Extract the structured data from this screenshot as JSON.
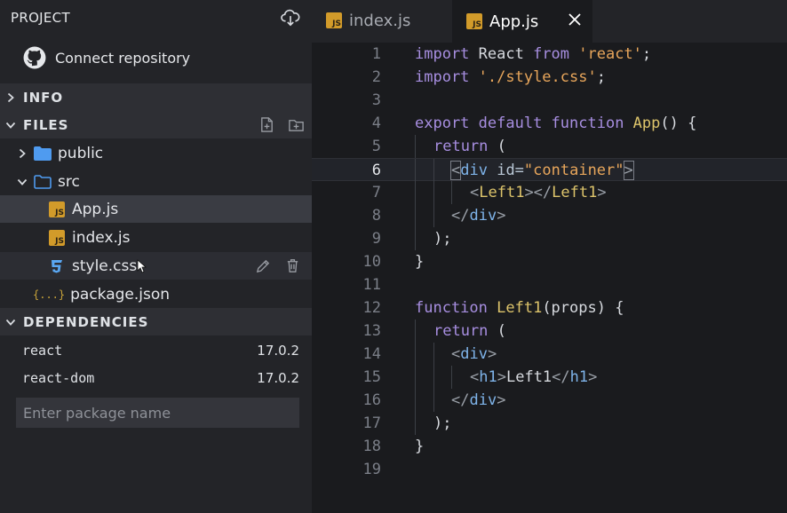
{
  "sidebar": {
    "project_title": "PROJECT",
    "connect_label": "Connect repository",
    "info_label": "INFO",
    "files_label": "FILES",
    "files": [
      {
        "name": "public",
        "type": "folder"
      },
      {
        "name": "src",
        "type": "folder-open"
      },
      {
        "name": "App.js",
        "type": "js"
      },
      {
        "name": "index.js",
        "type": "js"
      },
      {
        "name": "style.css",
        "type": "css"
      },
      {
        "name": "package.json",
        "type": "json"
      }
    ],
    "dependencies_label": "DEPENDENCIES",
    "dependencies": [
      {
        "name": "react",
        "version": "17.0.2"
      },
      {
        "name": "react-dom",
        "version": "17.0.2"
      }
    ],
    "package_placeholder": "Enter package name"
  },
  "tabs": [
    {
      "label": "index.js",
      "active": false
    },
    {
      "label": "App.js",
      "active": true
    }
  ],
  "icons": {
    "js_badge": "JS",
    "json_badge": "{...}"
  },
  "colors": {
    "js_icon": "#d29b2a",
    "folder": "#4f9bf0",
    "keyword": "#a78ee0",
    "function": "#ddc46b",
    "string": "#e8a65b",
    "tag": "#7fb4ea"
  },
  "editor": {
    "current_line": 6,
    "line_numbers": [
      "1",
      "2",
      "3",
      "4",
      "5",
      "6",
      "7",
      "8",
      "9",
      "10",
      "11",
      "12",
      "13",
      "14",
      "15",
      "16",
      "17",
      "18",
      "19"
    ],
    "code": {
      "l1": {
        "kw1": "import",
        "id": " React ",
        "kw2": "from",
        "str": " 'react'",
        "end": ";"
      },
      "l2": {
        "kw1": "import",
        "str": " './style.css'",
        "end": ";"
      },
      "l4": {
        "kw1": "export",
        "kw2": " default",
        "kw3": " function",
        "fn": " App",
        "end": "() {"
      },
      "l5": {
        "kw1": "return",
        "end": " ("
      },
      "l6": {
        "open": "<",
        "tn": "div",
        "attr": " id=",
        "str": "\"container\"",
        "close": ">"
      },
      "l7": {
        "open": "<",
        "comp1": "Left1",
        "mid": "></",
        "comp2": "Left1",
        "close": ">"
      },
      "l8": {
        "open": "</",
        "tn": "div",
        "close": ">"
      },
      "l9": {
        "text": ");"
      },
      "l10": {
        "text": "}"
      },
      "l12": {
        "kw1": "function",
        "fn": " Left1",
        "end": "(props) {"
      },
      "l13": {
        "kw1": "return",
        "end": " ("
      },
      "l14": {
        "open": "<",
        "tn": "div",
        "close": ">"
      },
      "l15": {
        "open": "<",
        "tn1": "h1",
        "mid1": ">",
        "text": "Left1",
        "mid2": "</",
        "tn2": "h1",
        "close": ">"
      },
      "l16": {
        "open": "</",
        "tn": "div",
        "close": ">"
      },
      "l17": {
        "text": ");"
      },
      "l18": {
        "text": "}"
      }
    }
  }
}
